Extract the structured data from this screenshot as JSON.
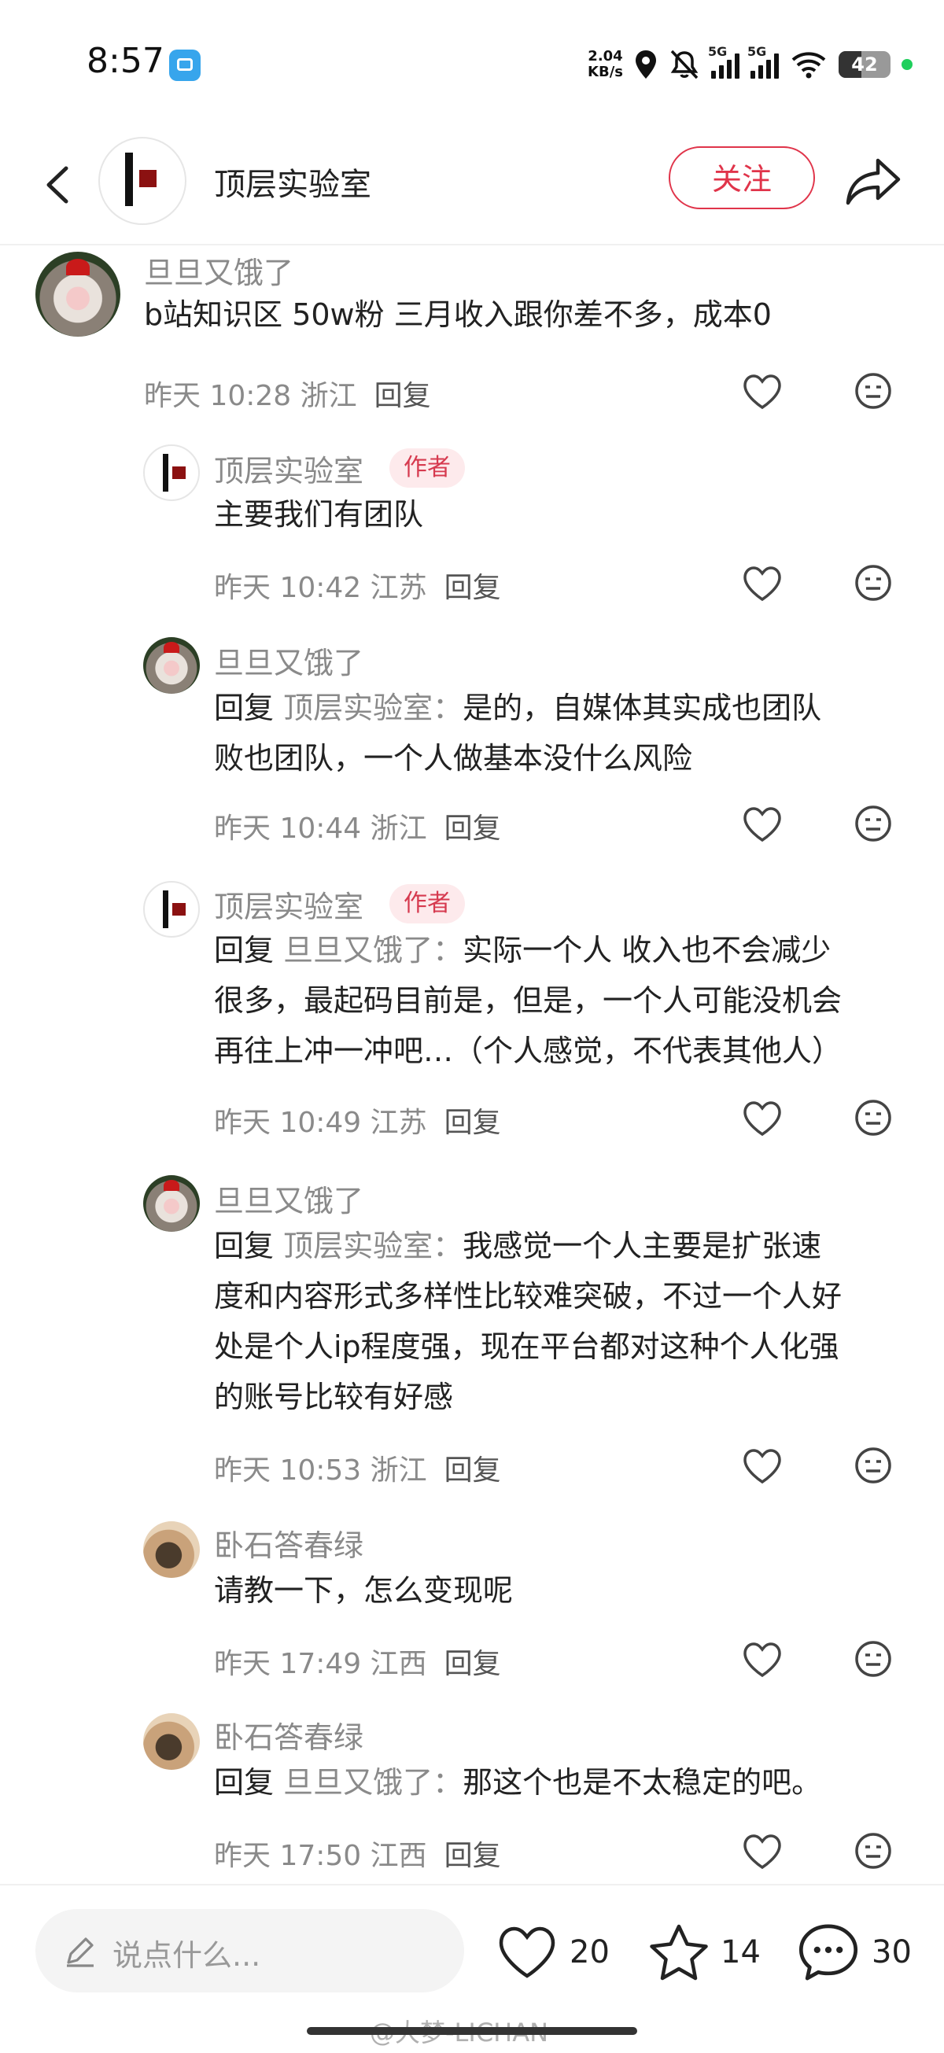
{
  "status_bar": {
    "time": "8:57",
    "net_speed_value": "2.04",
    "net_speed_unit": "KB/s",
    "signal1_label": "5G",
    "signal2_label": "5G",
    "battery": "42"
  },
  "header": {
    "title": "顶层实验室",
    "follow_label": "关注"
  },
  "comments": [
    {
      "user": "旦旦又饿了",
      "text": "b站知识区 50w粉 三月收入跟你差不多，成本0",
      "time": "昨天 10:28 浙江",
      "reply_label": "回复"
    },
    {
      "user": "顶层实验室",
      "author_tag": "作者",
      "text": "主要我们有团队",
      "time": "昨天 10:42 江苏",
      "reply_label": "回复"
    },
    {
      "user": "旦旦又饿了",
      "reply_prefix": "回复",
      "reply_target": "顶层实验室：",
      "text_line1": "是的，自媒体其实成也团队",
      "text_line2": "败也团队，一个人做基本没什么风险",
      "time": "昨天 10:44 浙江",
      "reply_label": "回复"
    },
    {
      "user": "顶层实验室",
      "author_tag": "作者",
      "reply_prefix": "回复",
      "reply_target": "旦旦又饿了：",
      "text_line1": "实际一个人 收入也不会减少",
      "text_line2": "很多，最起码目前是，但是，一个人可能没机会",
      "text_line3": "再往上冲一冲吧…（个人感觉，不代表其他人）",
      "time": "昨天 10:49 江苏",
      "reply_label": "回复"
    },
    {
      "user": "旦旦又饿了",
      "reply_prefix": "回复",
      "reply_target": "顶层实验室：",
      "text_line1": "我感觉一个人主要是扩张速",
      "text_line2": "度和内容形式多样性比较难突破，不过一个人好",
      "text_line3": "处是个人ip程度强，现在平台都对这种个人化强",
      "text_line4": "的账号比较有好感",
      "time": "昨天 10:53 浙江",
      "reply_label": "回复"
    },
    {
      "user": "卧石答春绿",
      "text": "请教一下，怎么变现呢",
      "time": "昨天 17:49 江西",
      "reply_label": "回复"
    },
    {
      "user": "卧石答春绿",
      "reply_prefix": "回复",
      "reply_target": "旦旦又饿了：",
      "text_line1": "那这个也是不太稳定的吧。",
      "time": "昨天 17:50 江西",
      "reply_label": "回复"
    }
  ],
  "bottom": {
    "input_placeholder": "说点什么...",
    "likes": "20",
    "stars": "14",
    "comments": "30",
    "watermark": "@大梦-LICHAN"
  },
  "colors": {
    "accent": "#e0344a",
    "author_tag_bg": "#fdeaec"
  }
}
